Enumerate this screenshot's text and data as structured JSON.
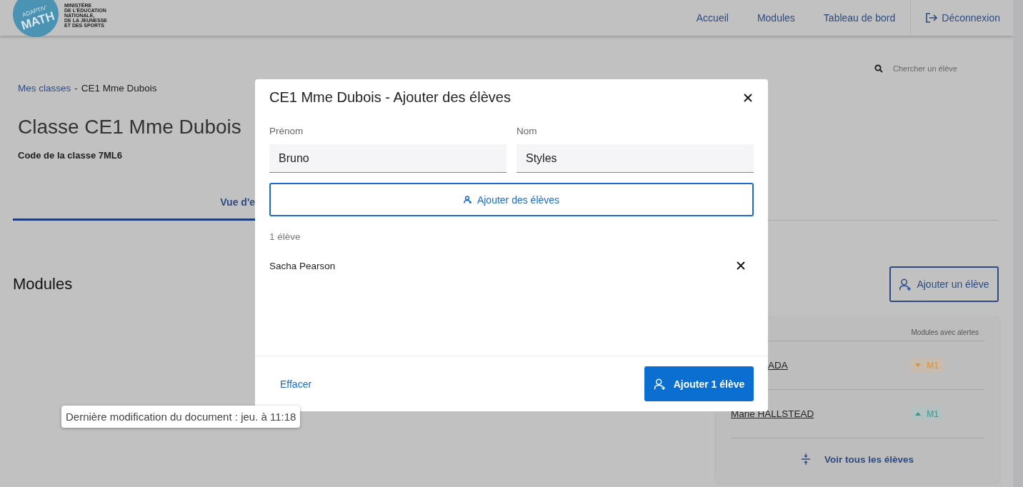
{
  "header": {
    "logo": {
      "badge_top": "ADAPTIV'",
      "badge_main": "MATH",
      "ministry": [
        "MINISTÈRE",
        "DE L'ÉDUCATION",
        "NATIONALE,",
        "DE LA JEUNESSE",
        "ET DES SPORTS"
      ]
    },
    "nav": [
      {
        "label": "Accueil"
      },
      {
        "label": "Modules"
      },
      {
        "label": "Tableau de bord"
      }
    ],
    "logout": "Déconnexion"
  },
  "page": {
    "search": {
      "placeholder": "Chercher un élève"
    },
    "breadcrumb": {
      "link": "Mes classes",
      "separator": "-",
      "current": "CE1 Mme Dubois"
    },
    "title": "Classe CE1 Mme Dubois",
    "class_code": "Code de la classe 7ML6",
    "tabs": [
      {
        "label": "Vue d'e",
        "selected": true
      }
    ],
    "modules_heading": "Modules",
    "add_student_button": "Ajouter un élève",
    "students_card": {
      "column_header": "Modules avec alertes",
      "rows": [
        {
          "name": "ADA",
          "badge": {
            "label": "M1",
            "kind": "down",
            "color": "#e0922e"
          }
        },
        {
          "name": "Marie HALLSTEAD",
          "badge": {
            "label": "M1",
            "kind": "up",
            "color": "#2a9a8e"
          }
        }
      ],
      "see_all": "Voir tous les élèves"
    }
  },
  "modal": {
    "title": "CE1 Mme Dubois - Ajouter des élèves",
    "fields": [
      {
        "label": "Prénom",
        "value": "Bruno"
      },
      {
        "label": "Nom",
        "value": "Styles"
      }
    ],
    "add_button": "Ajouter des élèves",
    "count": "1 élève",
    "students": [
      {
        "name": "Sacha Pearson"
      }
    ],
    "clear": "Effacer",
    "submit": "Ajouter 1 élève"
  },
  "tooltip": {
    "text": "Dernière modification du document : jeu. à 11:18"
  }
}
